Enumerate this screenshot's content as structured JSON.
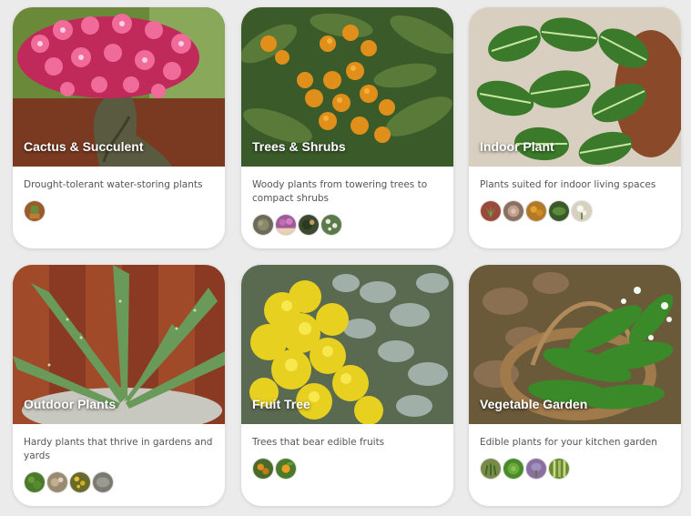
{
  "categories": [
    {
      "title": "Cactus & Succulent",
      "description": "Drought-tolerant water-storing plants",
      "image_icon": "desert-rose-photo",
      "thumbnails": [
        {
          "icon": "cactus-pot-thumbnail",
          "color": "#9a5a2c"
        }
      ]
    },
    {
      "title": "Trees & Shrubs",
      "description": "Woody plants from towering trees to compact shrubs",
      "image_icon": "loquat-tree-photo",
      "thumbnails": [
        {
          "icon": "shrub-thumbnail",
          "color": "#6e6a5a"
        },
        {
          "icon": "heather-thumbnail",
          "color": "#a05a9a"
        },
        {
          "icon": "evergreen-thumbnail",
          "color": "#3d4a30"
        },
        {
          "icon": "white-flower-shrub-thumbnail",
          "color": "#5a7a4a"
        }
      ]
    },
    {
      "title": "Indoor Plant",
      "description": "Plants suited for indoor living spaces",
      "image_icon": "calathea-photo",
      "thumbnails": [
        {
          "icon": "aloe-thumbnail",
          "color": "#9a4a3a"
        },
        {
          "icon": "succulent-rosette-thumbnail",
          "color": "#8a7060"
        },
        {
          "icon": "marigold-thumbnail",
          "color": "#b07a2a"
        },
        {
          "icon": "leafy-plant-thumbnail",
          "color": "#3a5a2a"
        },
        {
          "icon": "white-orchid-thumbnail",
          "color": "#d8d0c0"
        }
      ]
    },
    {
      "title": "Outdoor Plants",
      "description": "Hardy plants that thrive in gardens and yards",
      "image_icon": "aloe-vera-photo",
      "thumbnails": [
        {
          "icon": "groundcover-thumbnail",
          "color": "#4a7a2a"
        },
        {
          "icon": "rock-garden-thumbnail",
          "color": "#9a8a70"
        },
        {
          "icon": "yellow-blooms-thumbnail",
          "color": "#6a6a2a"
        },
        {
          "icon": "grey-foliage-thumbnail",
          "color": "#7a7a70"
        }
      ]
    },
    {
      "title": "Fruit Tree",
      "description": "Trees that bear edible fruits",
      "image_icon": "acacia-blossom-photo",
      "thumbnails": [
        {
          "icon": "fruit-branch-thumbnail",
          "color": "#c07a2a"
        },
        {
          "icon": "citrus-thumbnail",
          "color": "#4a7a2a"
        }
      ]
    },
    {
      "title": "Vegetable Garden",
      "description": "Edible plants for your kitchen garden",
      "image_icon": "wild-garlic-basket-photo",
      "thumbnails": [
        {
          "icon": "seedlings-thumbnail",
          "color": "#7a8a4a"
        },
        {
          "icon": "lettuce-thumbnail",
          "color": "#4a8a2a"
        },
        {
          "icon": "lavender-thumbnail",
          "color": "#8a70a0"
        },
        {
          "icon": "leek-thumbnail",
          "color": "#6a8a2a"
        }
      ]
    }
  ]
}
